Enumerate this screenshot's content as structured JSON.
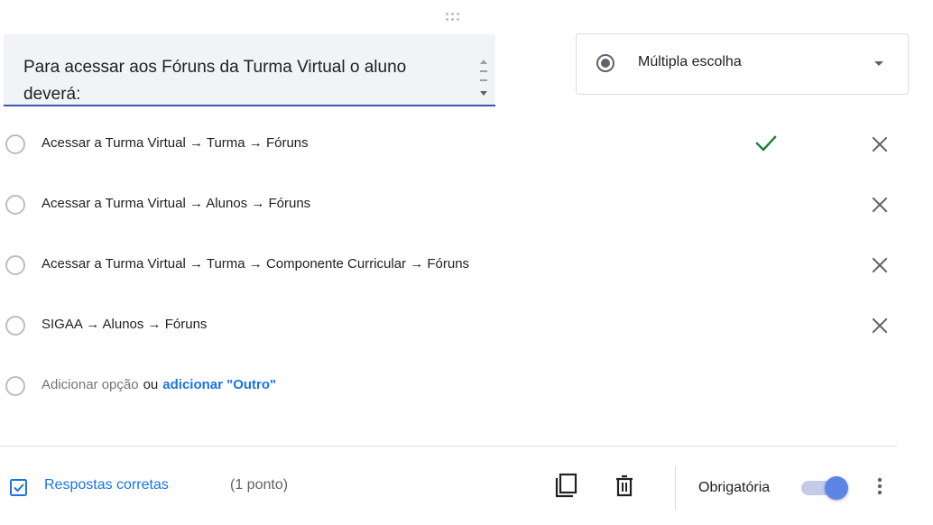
{
  "question": {
    "text": "Para acessar aos Fóruns da Turma Virtual o aluno deverá:"
  },
  "type_select": {
    "label": "Múltipla escolha",
    "icon": "radio-button-checked-icon"
  },
  "options": [
    {
      "label": "Acessar a Turma Virtual → Turma → Fóruns",
      "correct": true
    },
    {
      "label": "Acessar a Turma Virtual → Alunos → Fóruns",
      "correct": false
    },
    {
      "label": "Acessar a Turma Virtual → Turma → Componente Curricular → Fóruns",
      "correct": false
    },
    {
      "label": "SIGAA → Alunos → Fóruns",
      "correct": false
    }
  ],
  "add_option": {
    "label": "Adicionar opção",
    "or": "ou",
    "other": "adicionar \"Outro\""
  },
  "footer": {
    "answer_key_label": "Respostas corretas",
    "points": "(1 ponto)",
    "required_label": "Obrigatória",
    "required_on": true
  },
  "colors": {
    "accent_blue": "#1a73e8",
    "underline_indigo": "#3f51b5",
    "check_green": "#188038",
    "toggle_knob": "#5c86e6"
  }
}
